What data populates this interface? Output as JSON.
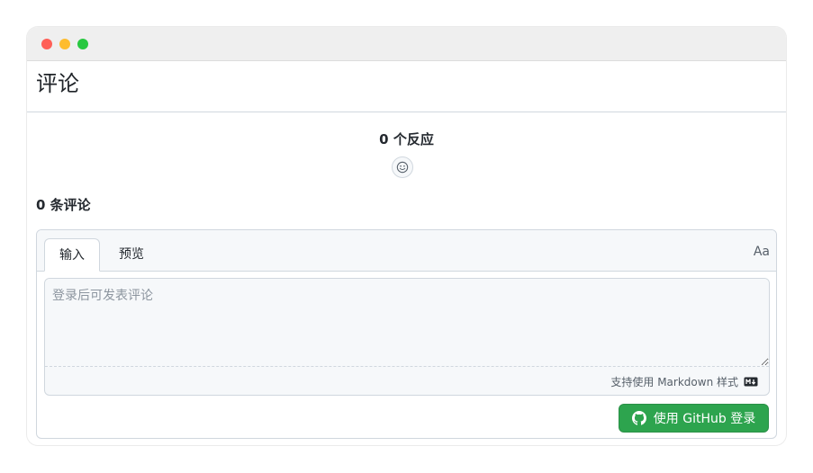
{
  "window": {
    "controls": [
      "close",
      "minimize",
      "zoom"
    ]
  },
  "page": {
    "title": "评论"
  },
  "reactions": {
    "count_label": "0 个反应",
    "add_icon": "smiley-icon"
  },
  "comments": {
    "count_label": "0 条评论"
  },
  "editor": {
    "tabs": [
      {
        "label": "输入",
        "active": true
      },
      {
        "label": "预览",
        "active": false
      }
    ],
    "font_toggle_label": "Aa",
    "input": {
      "value": "",
      "placeholder": "登录后可发表评论"
    },
    "markdown_hint": "支持使用 Markdown 样式",
    "markdown_icon": "markdown-icon"
  },
  "actions": {
    "login_button_label": "使用 GitHub 登录",
    "login_icon": "github-icon"
  },
  "colors": {
    "accent_green": "#2da44e",
    "border": "#d0d7de",
    "muted_bg": "#f6f8fa"
  }
}
